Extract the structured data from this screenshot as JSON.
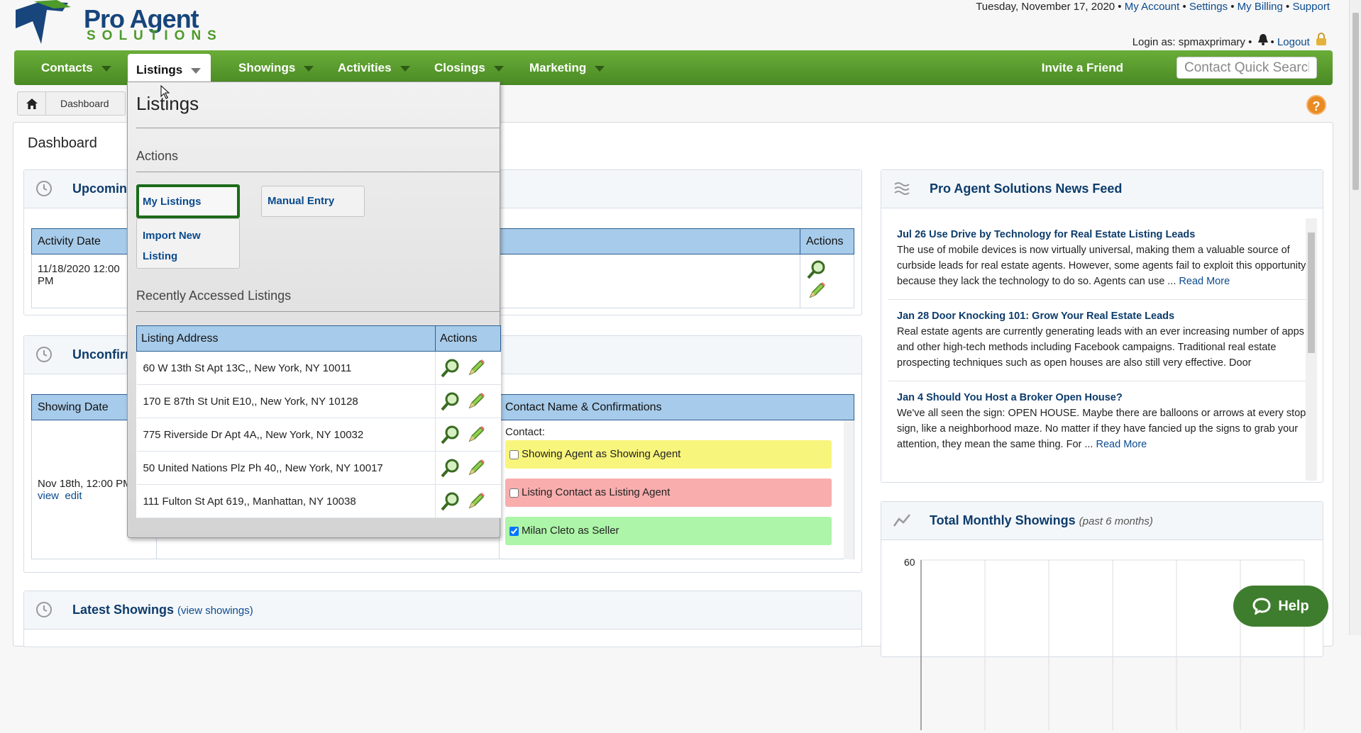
{
  "header": {
    "logo_line1": "Pro Agent",
    "logo_line2": "SOLUTIONS",
    "date": "Tuesday, November 17, 2020",
    "links": [
      "My Account",
      "Settings",
      "My Billing",
      "Support"
    ],
    "login_text": "Login as: spmaxprimary",
    "logout": "Logout"
  },
  "nav": {
    "items": [
      "Contacts",
      "Listings",
      "Showings",
      "Activities",
      "Closings",
      "Marketing"
    ],
    "active": "Listings",
    "invite": "Invite a Friend",
    "search_placeholder": "Contact Quick Search"
  },
  "breadcrumb": {
    "items": [
      "Dashboard"
    ]
  },
  "dashboard": {
    "title": "Dashboard",
    "upcoming": {
      "title": "Upcoming",
      "col_date": "Activity Date",
      "col_actions": "Actions",
      "row_date": "11/18/2020 12:00 PM"
    },
    "unconfirmed": {
      "title": "Unconfirm",
      "col_date": "Showing Date",
      "col_contact": "Contact Name & Confirmations",
      "row_date": "Nov 18th, 12:00 PM",
      "view": "view",
      "edit": "edit",
      "contact_label": "Contact:",
      "confirmations": [
        {
          "label": "Showing Agent as Showing Agent",
          "checked": false,
          "color": "#f8f57c"
        },
        {
          "label": "Listing Contact as Listing Agent",
          "checked": false,
          "color": "#f9adad"
        },
        {
          "label": "Milan Cleto as Seller",
          "checked": true,
          "color": "#adf5a8"
        }
      ]
    },
    "latest": {
      "title": "Latest Showings",
      "sub": "(view showings)"
    },
    "news": {
      "title": "Pro Agent Solutions News Feed",
      "items": [
        {
          "title": "Jul 26 Use Drive by Technology for Real Estate Listing Leads",
          "body": "The use of mobile devices is now virtually universal, making them a valuable source of curbside leads for real estate agents. However, some agents fail to exploit this opportunity because they lack the technology to do so. Agents can use ...",
          "more": "Read More"
        },
        {
          "title": "Jan 28 Door Knocking 101: Grow Your Real Estate Leads",
          "body": "Real estate agents are currently generating leads with an ever increasing number of apps and other high-tech methods including Facebook campaigns. Traditional real estate prospecting techniques such as open houses are also still very effective. Door",
          "more": ""
        },
        {
          "title": "Jan 4 Should You Host a Broker Open House?",
          "body": "We've all seen the sign: OPEN HOUSE. Maybe there are balloons or arrows at every stop sign, like a neighborhood maze. No matter if they have fancied up the signs to grab your attention, they mean the same thing. For ...",
          "more": "Read More"
        }
      ]
    },
    "monthly": {
      "title": "Total Monthly Showings",
      "sub": "(past 6 months)"
    }
  },
  "dropdown": {
    "title": "Listings",
    "actions_label": "Actions",
    "buttons": [
      "My Listings",
      "Manual Entry",
      "Import New Listing"
    ],
    "selected": "My Listings",
    "recent_label": "Recently Accessed Listings",
    "col_address": "Listing Address",
    "col_actions": "Actions",
    "listings": [
      "60 W 13th St Apt 13C,, New York, NY 10011",
      "170 E 87th St Unit E10,, New York, NY 10128",
      "775 Riverside Dr Apt 4A,, New York, NY 10032",
      "50 United Nations Plz Ph 40,, New York, NY 10017",
      "111 Fulton St Apt 619,, Manhattan, NY 10038"
    ]
  },
  "help_button": "Help",
  "chart_data": {
    "type": "bar",
    "title": "Total Monthly Showings",
    "subtitle": "(past 6 months)",
    "categories": [],
    "values": [],
    "ytick_top": "60",
    "ylim": [
      0,
      60
    ],
    "grid": true
  }
}
